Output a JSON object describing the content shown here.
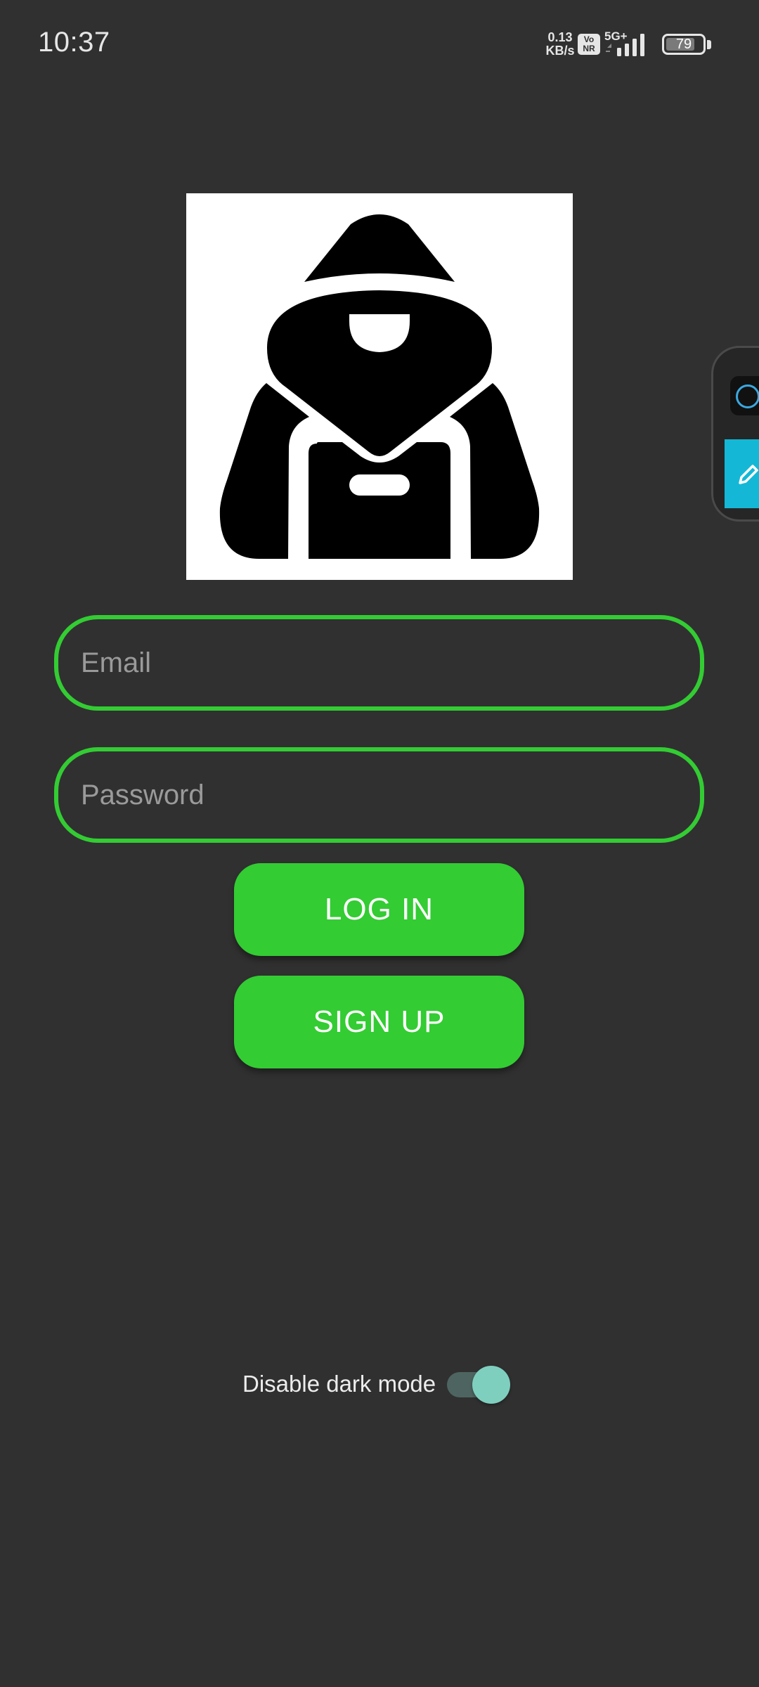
{
  "status_bar": {
    "time": "10:37",
    "net_speed_value": "0.13",
    "net_speed_unit": "KB/s",
    "volte_badge_top": "Vo",
    "volte_badge_bottom": "NR",
    "network_type": "5G+",
    "battery_level": "79",
    "signal_icon": "signal-bars-icon"
  },
  "logo": {
    "icon": "hooded-figure-with-backpack-icon",
    "background_color": "#ffffff"
  },
  "form": {
    "email_placeholder": "Email",
    "email_value": "",
    "password_placeholder": "Password",
    "password_value": "",
    "login_label": "LOG IN",
    "signup_label": "SIGN UP"
  },
  "settings": {
    "dark_mode_label": "Disable dark mode",
    "dark_mode_toggle_on": true
  },
  "floating_widget": {
    "icons": [
      "app-icon",
      "edit-pencil-icon"
    ]
  },
  "colors": {
    "background": "#303030",
    "accent": "#33cc33",
    "toggle_thumb": "#7fcfbf",
    "toggle_track": "#4e6460",
    "widget_accent": "#14b8d6"
  }
}
